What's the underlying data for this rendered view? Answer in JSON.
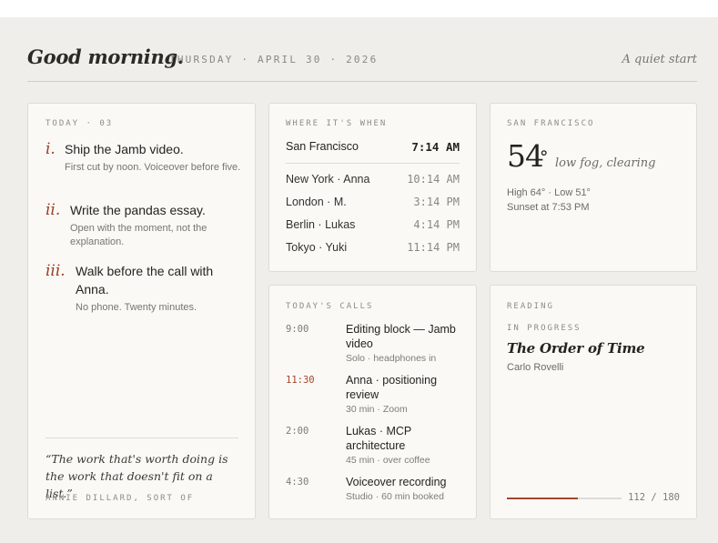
{
  "header": {
    "greeting": "Good morning.",
    "date": "THURSDAY · APRIL 30 · 2026",
    "tagline": "A quiet start"
  },
  "today": {
    "label": "TODAY · 03",
    "tasks": [
      {
        "num": "i.",
        "title": "Ship the Jamb video.",
        "sub": "First cut by noon. Voiceover before five."
      },
      {
        "num": "ii.",
        "title": "Write the pandas essay.",
        "sub": "Open with the moment, not the explanation."
      },
      {
        "num": "iii.",
        "title": "Walk before the call with Anna.",
        "sub": "No phone. Twenty minutes."
      }
    ],
    "quote": "“The work that's worth doing is the work that doesn't fit on a list.”",
    "quote_attribution": "ANNIE DILLARD, SORT OF"
  },
  "clocks": {
    "label": "WHERE IT'S WHEN",
    "home": {
      "city": "San Francisco",
      "time": "7:14 AM"
    },
    "others": [
      {
        "city": "New York · Anna",
        "time": "10:14 AM"
      },
      {
        "city": "London · M.",
        "time": "3:14 PM"
      },
      {
        "city": "Berlin · Lukas",
        "time": "4:14 PM"
      },
      {
        "city": "Tokyo · Yuki",
        "time": "11:14 PM"
      }
    ]
  },
  "weather": {
    "label": "SAN FRANCISCO",
    "temp": "54",
    "deg": "°",
    "conditions": "low fog, clearing",
    "hilo": "High 64° · Low 51°",
    "sunset": "Sunset at 7:53 PM"
  },
  "calls": {
    "label": "TODAY'S CALLS",
    "items": [
      {
        "time": "9:00",
        "title": "Editing block — Jamb video",
        "sub": "Solo · headphones in",
        "current": false
      },
      {
        "time": "11:30",
        "title": "Anna · positioning review",
        "sub": "30 min · Zoom",
        "current": true
      },
      {
        "time": "2:00",
        "title": "Lukas · MCP architecture",
        "sub": "45 min · over coffee",
        "current": false
      },
      {
        "time": "4:30",
        "title": "Voiceover recording",
        "sub": "Studio · 60 min booked",
        "current": false
      }
    ]
  },
  "reading": {
    "label": "READING",
    "status": "IN PROGRESS",
    "title": "The Order of Time",
    "author": "Carlo Rovelli",
    "pages_read": 112,
    "pages_total": 180,
    "progress_text": "112 / 180"
  },
  "colors": {
    "accent": "#a3472a",
    "background": "#efeeea",
    "card": "#faf9f6"
  }
}
